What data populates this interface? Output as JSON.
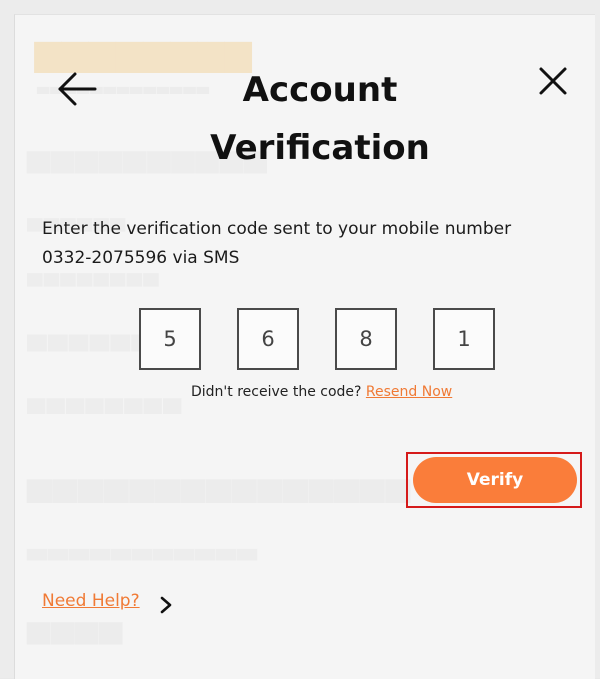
{
  "modal": {
    "title": "Account Verification",
    "instructions": "Enter the verification code sent to your mobile number 0332-2075596 via SMS",
    "code_digits": [
      "5",
      "6",
      "8",
      "1"
    ],
    "resend_prompt": "Didn't receive the code?",
    "resend_link": "Resend Now",
    "verify_label": "Verify",
    "help_link": "Need Help?"
  },
  "icons": {
    "back": "arrow-left-icon",
    "close": "close-icon",
    "help_chevron": "chevron-right-icon"
  },
  "colors": {
    "accent": "#fa7d3a",
    "link": "#f07a35",
    "highlight_border": "#d51a1a",
    "text": "#111111"
  }
}
